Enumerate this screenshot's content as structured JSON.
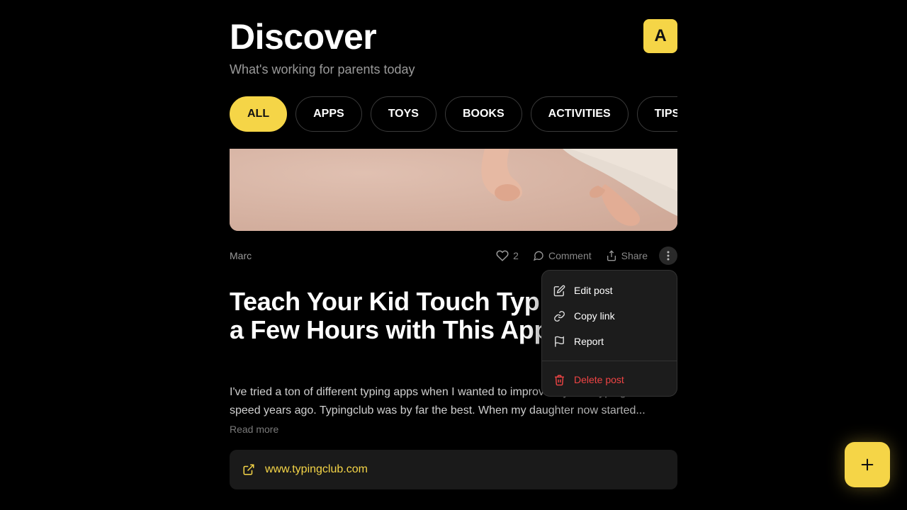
{
  "header": {
    "title": "Discover",
    "subtitle": "What's working for parents today",
    "avatar_initial": "A"
  },
  "filters": [
    {
      "label": "ALL",
      "active": true
    },
    {
      "label": "APPS",
      "active": false
    },
    {
      "label": "TOYS",
      "active": false
    },
    {
      "label": "BOOKS",
      "active": false
    },
    {
      "label": "ACTIVITIES",
      "active": false
    },
    {
      "label": "TIPS",
      "active": false
    }
  ],
  "post": {
    "author": "Marc",
    "likes": "2",
    "comment_label": "Comment",
    "share_label": "Share",
    "title": "Teach Your Kid Touch Typing in Just a Few Hours with This App",
    "body_line_1": "I've tried a ton of different typing apps when I wanted to improve my own typing",
    "body_line_2": "speed years ago. Typingclub was by far the best. When my daughter now started...",
    "read_more": "Read more",
    "link": "www.typingclub.com"
  },
  "menu": {
    "edit": "Edit post",
    "copy": "Copy link",
    "report": "Report",
    "delete": "Delete post"
  },
  "colors": {
    "accent": "#f5d547",
    "danger": "#ef4444",
    "background": "#000000"
  },
  "icons": [
    "heart-icon",
    "comment-icon",
    "share-icon",
    "more-icon",
    "edit-icon",
    "link-icon",
    "flag-icon",
    "trash-icon",
    "external-link-icon",
    "plus-icon"
  ]
}
